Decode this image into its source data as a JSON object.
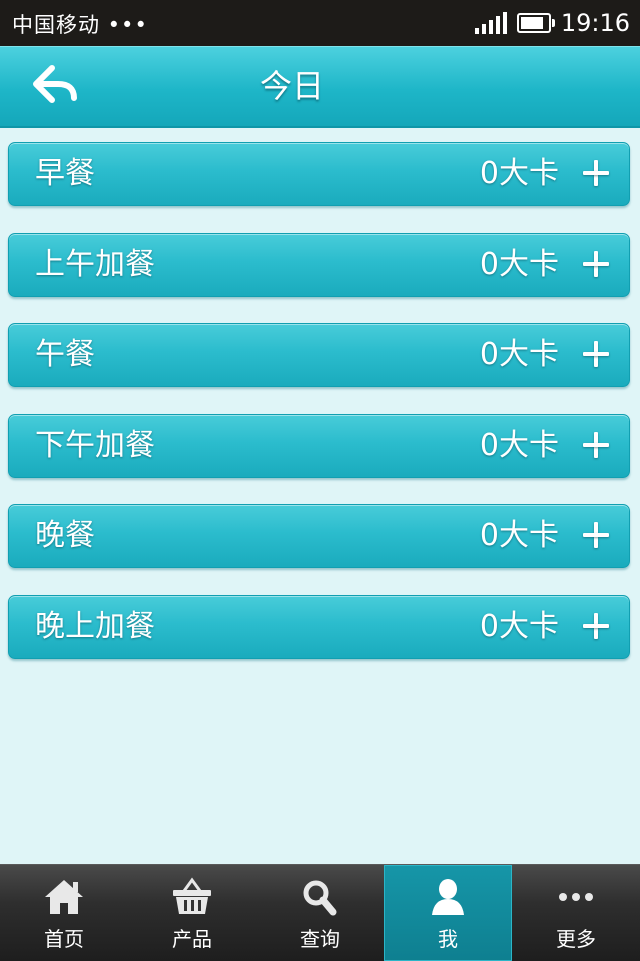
{
  "status_bar": {
    "carrier": "中国移动 •••",
    "time": "19:16"
  },
  "header": {
    "title": "今日",
    "back_icon": "back-arrow-icon"
  },
  "meals": [
    {
      "name": "早餐",
      "calories": "0大卡"
    },
    {
      "name": "上午加餐",
      "calories": "0大卡"
    },
    {
      "name": "午餐",
      "calories": "0大卡"
    },
    {
      "name": "下午加餐",
      "calories": "0大卡"
    },
    {
      "name": "晚餐",
      "calories": "0大卡"
    },
    {
      "name": "晚上加餐",
      "calories": "0大卡"
    }
  ],
  "tabs": [
    {
      "label": "首页",
      "icon": "home-icon"
    },
    {
      "label": "产品",
      "icon": "basket-icon"
    },
    {
      "label": "查询",
      "icon": "search-icon"
    },
    {
      "label": "我",
      "icon": "user-icon",
      "active": true
    },
    {
      "label": "更多",
      "icon": "more-icon"
    }
  ],
  "colors": {
    "accent": "#1eb6c8",
    "background": "#dff5f7",
    "tabbar": "#2e2e2e",
    "active_tab": "#0e7f90"
  }
}
